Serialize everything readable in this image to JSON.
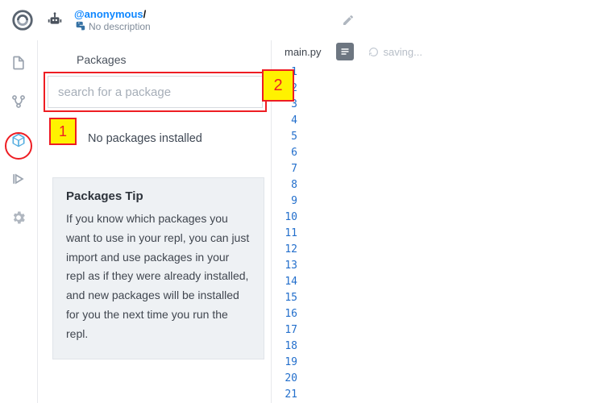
{
  "header": {
    "username": "@anonymous",
    "slash": "/",
    "description": "No description"
  },
  "panel": {
    "title": "Packages",
    "search_placeholder": "search for a package",
    "empty_text": "No packages installed",
    "tip_title": "Packages Tip",
    "tip_body": "If you know which packages you want to use in your repl, you can just import and use packages in your repl as if they were already installed, and new packages will be installed for you the next time you run the repl."
  },
  "editor": {
    "filename": "main.py",
    "saving": "saving...",
    "line_count": 21
  },
  "callouts": {
    "c1": "1",
    "c2": "2"
  }
}
